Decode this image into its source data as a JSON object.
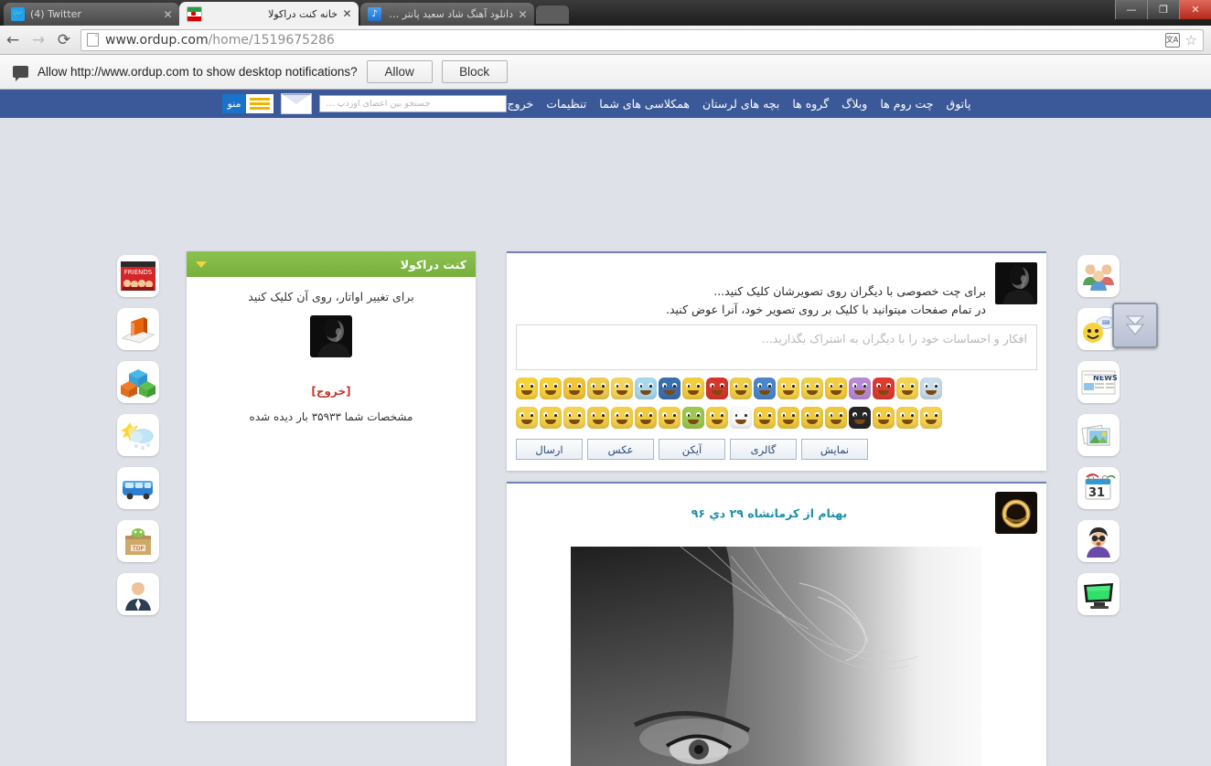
{
  "browser": {
    "tabs": [
      {
        "title": "(4) Twitter",
        "favicon": "twitter-icon",
        "active": false
      },
      {
        "title": "خانه کنت دراکولا",
        "favicon": "iran-flag-icon",
        "active": true
      },
      {
        "title": "دانلود آهنگ شاد سعید پانتر و ...",
        "favicon": "music-note-icon",
        "active": false
      }
    ],
    "close_glyph": "✕",
    "back_glyph": "←",
    "forward_glyph": "→",
    "reload_glyph": "⟳",
    "url_host": "www.ordup.com",
    "url_path": "/home/1519675286",
    "translate_label": "文A",
    "star_glyph": "☆",
    "window": {
      "minimize": "—",
      "maximize": "❐",
      "close": "✕"
    }
  },
  "notification": {
    "message": "Allow http://www.ordup.com to show desktop notifications?",
    "allow_label": "Allow",
    "block_label": "Block"
  },
  "sitenav": {
    "links": [
      "پاتوق",
      "چت روم ها",
      "وبلاگ",
      "گروه ها",
      "بچه های لرستان",
      "همکلاسی های شما",
      "تنظیمات",
      "خروج"
    ],
    "menu_label": "منو",
    "search_placeholder": "جستجو بین اعضای اوردپ ...",
    "bg_color": "#3b5998"
  },
  "left_panel": {
    "title": "کنت دراکولا",
    "avatar_hint": "برای تغییر اواتار، روی آن کلیک کنید",
    "logout_label": "[خروج]",
    "views_text": "مشخصات شما ۳۵۹۳۳ بار دیده شده",
    "header_color": "#7ab648"
  },
  "compose": {
    "hint_line_1": "برای چت خصوصی با دیگران روی تصویرشان کلیک کنید...",
    "hint_line_2": "در تمام صفحات میتوانید با کلیک بر روی تصویر خود، آنرا عوض کنید.",
    "placeholder": "افکار و احساسات خود را با دیگران به اشتراک بگذارید...",
    "buttons": [
      "ارسال",
      "عکس",
      "آیکن",
      "گالری",
      "نمایش"
    ],
    "emoji_rows": [
      [
        "#f7d13a",
        "#f6cf3c",
        "#f2c43a",
        "#edcb4c",
        "#f4d45a",
        "#a8d8ef",
        "#3a6fb0",
        "#f3cd3e",
        "#d9352b",
        "#f0cd45",
        "#4a86c8",
        "#f6d24a",
        "#eed24c",
        "#f2cb3e",
        "#b88ad6",
        "#e03a2f",
        "#f5d250",
        "#c8dcea"
      ],
      [
        "#f5d24c",
        "#f3cf45",
        "#f6d252",
        "#f2cb44",
        "#f4d04a",
        "#f1c93e",
        "#f3cf46",
        "#9ec84f",
        "#f3cd42",
        "#fafafa",
        "#f2cc40",
        "#f0c93c",
        "#efc93e",
        "#eec83d",
        "#262626",
        "#f2cb41",
        "#f3d04a",
        "#f5d252"
      ]
    ]
  },
  "post": {
    "byline": "بهنام از کرمانشاه ۲۹ دي ۹۶"
  },
  "rails": {
    "left_icons": [
      "friends-poster-icon",
      "book-icon",
      "blocks-icon",
      "weather-icon",
      "bus-icon",
      "shopping-bag-icon",
      "person-icon"
    ],
    "right_icons": [
      "people-group-icon",
      "smiley-chat-icon",
      "news-icon",
      "photos-icon",
      "calendar-icon",
      "person-glasses-icon",
      "monitor-icon"
    ],
    "calendar_day": "31",
    "news_label": "NEWS",
    "shop_label": "TOP",
    "friends_label": "FRIENDS"
  },
  "scroll_widget": {
    "name": "scroll-down-button"
  }
}
